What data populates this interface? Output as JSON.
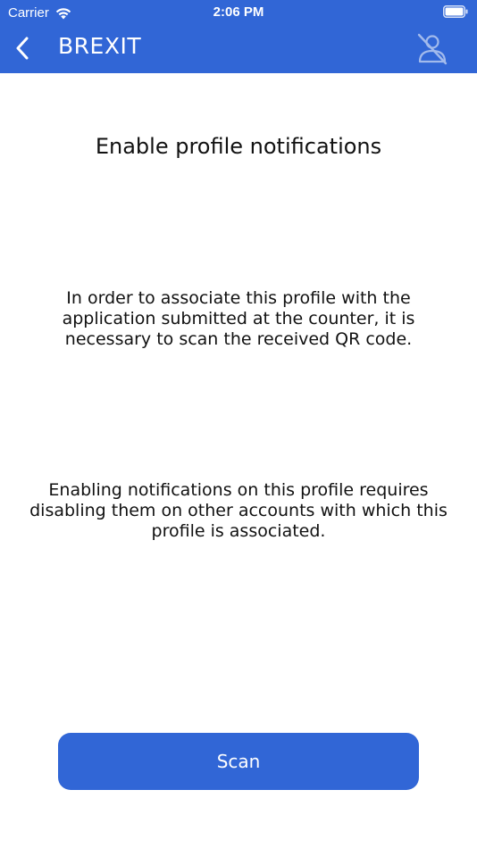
{
  "status_bar": {
    "carrier": "Carrier",
    "time": "2:06 PM",
    "wifi_icon": "wifi-icon",
    "battery_icon": "battery-icon"
  },
  "nav_bar": {
    "title": "BREXIT",
    "back_icon": "chevron-left-icon",
    "profile_icon": "user-off-icon"
  },
  "content": {
    "title": "Enable profile notifications",
    "paragraph_1": "In order to associate this profile with the application submitted at the counter, it is necessary to scan the received QR code.",
    "paragraph_2": "Enabling notifications on this profile requires disabling them on other accounts with which this profile is associated."
  },
  "actions": {
    "scan_label": "Scan"
  },
  "colors": {
    "primary": "#3166d6",
    "background": "#ffffff",
    "text": "#111111"
  }
}
